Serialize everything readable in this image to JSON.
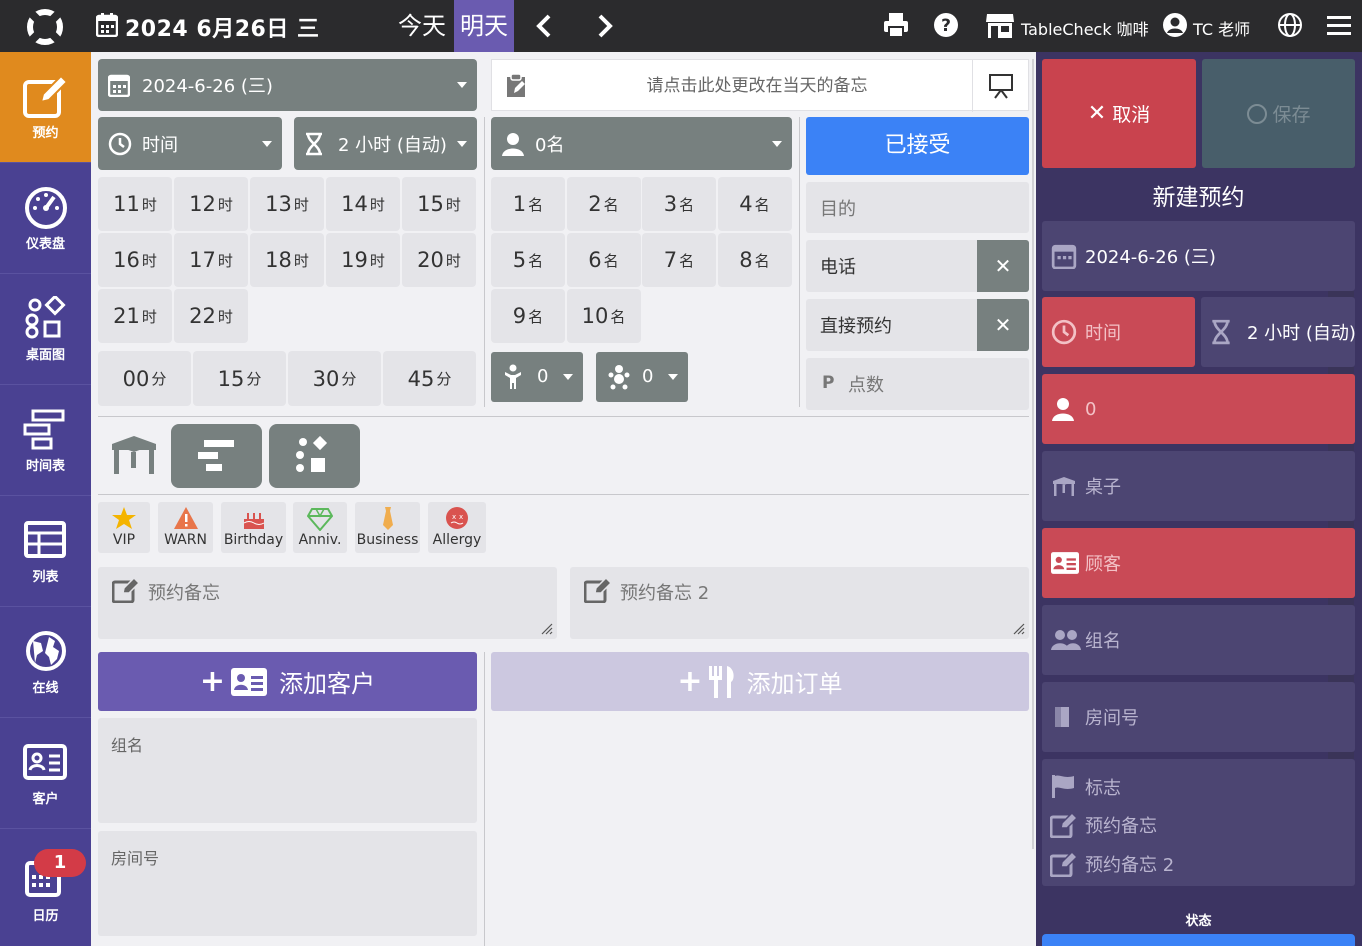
{
  "topbar": {
    "date_title": "2024 6月26日 三",
    "today_label": "今天",
    "tomorrow_label": "明天",
    "store_name": "TableCheck 咖啡",
    "user_name": "TC 老师"
  },
  "nav": {
    "items": [
      {
        "label": "预约",
        "icon": "edit-icon",
        "active": true
      },
      {
        "label": "仪表盘",
        "icon": "dashboard-icon"
      },
      {
        "label": "桌面图",
        "icon": "floorplan-icon"
      },
      {
        "label": "时间表",
        "icon": "timeline-icon"
      },
      {
        "label": "列表",
        "icon": "table-icon"
      },
      {
        "label": "在线",
        "icon": "globe-icon"
      },
      {
        "label": "客户",
        "icon": "contact-card-icon"
      },
      {
        "label": "日历",
        "icon": "calendar-icon"
      }
    ],
    "calendar_badge": "1"
  },
  "form": {
    "date": "2024-6-26 (三)",
    "memo_placeholder": "请点击此处更改在当天的备忘",
    "time_label": "时间",
    "duration_label": "2 小时 (自动)",
    "party_label": "0名",
    "hours": [
      "11",
      "12",
      "13",
      "14",
      "15",
      "16",
      "17",
      "18",
      "19",
      "20",
      "21",
      "22"
    ],
    "hour_unit": "时",
    "minutes": [
      "00",
      "15",
      "30",
      "45"
    ],
    "minute_unit": "分",
    "party_sizes": [
      "1",
      "2",
      "3",
      "4",
      "5",
      "6",
      "7",
      "8",
      "9",
      "10"
    ],
    "party_unit": "名",
    "children_count": "0",
    "babies_count": "0",
    "status_accepted": "已接受",
    "purpose_placeholder": "目的",
    "phone_label": "电话",
    "direct_label": "直接预约",
    "points_placeholder": "点数",
    "tags": [
      {
        "label": "VIP",
        "icon": "star-icon",
        "color": "#f4b400"
      },
      {
        "label": "WARN",
        "icon": "warning-icon",
        "color": "#e8754a"
      },
      {
        "label": "Birthday",
        "icon": "cake-icon",
        "color": "#d9534f"
      },
      {
        "label": "Anniv.",
        "icon": "diamond-icon",
        "color": "#5cb85c"
      },
      {
        "label": "Business",
        "icon": "tie-icon",
        "color": "#f0ad4e"
      },
      {
        "label": "Allergy",
        "icon": "dizzy-face-icon",
        "color": "#d9534f"
      }
    ],
    "note1_placeholder": "预约备忘",
    "note2_placeholder": "预约备忘 2",
    "add_customer_label": "添加客户",
    "add_order_label": "添加订单",
    "group_name_label": "组名",
    "room_label": "房间号"
  },
  "summary": {
    "cancel_label": "取消",
    "save_label": "保存",
    "title": "新建预约",
    "date": "2024-6-26 (三)",
    "time_label": "时间",
    "duration_label": "2 小时 (自动)",
    "party": "0",
    "table_label": "桌子",
    "customer_label": "顾客",
    "group_label": "组名",
    "room_label": "房间号",
    "flag_label": "标志",
    "note1_label": "预约备忘",
    "note2_label": "预约备忘 2",
    "status_label": "状态"
  },
  "colors": {
    "topbar": "#2b2b2d",
    "nav": "#4a4192",
    "nav_active": "#e08a1e",
    "accepted": "#3b82f6",
    "cancel": "#c9434e",
    "add_customer": "#6a5bb0",
    "right_panel": "#3c3462"
  }
}
